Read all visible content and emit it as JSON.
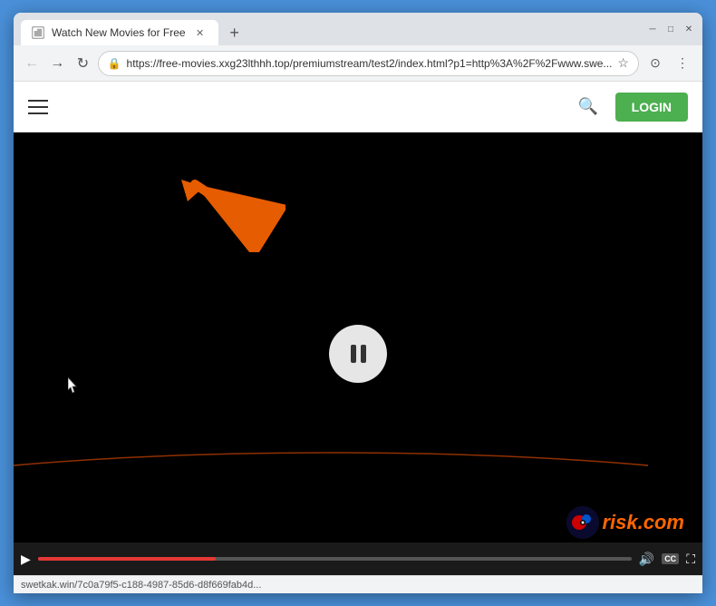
{
  "browser": {
    "tab": {
      "title": "Watch New Movies for Free",
      "favicon_label": "page"
    },
    "new_tab_symbol": "+",
    "window_controls": {
      "minimize": "─",
      "maximize": "□",
      "close": "✕"
    },
    "nav": {
      "back_label": "←",
      "forward_label": "→",
      "reload_label": "↻",
      "url": "https://free-movies.xxg23lthhh.top/premiumstream/test2/index.html?p1=http%3A%2F%2Fwww.swe...",
      "bookmark_symbol": "☆"
    },
    "nav_extra": {
      "profile": "⊙",
      "menu": "⋮"
    },
    "status_bar": {
      "text": "swetkak.win/7c0a79f5-c188-4987-85d6-d8f669fab4d..."
    }
  },
  "site": {
    "hamburger_label": "menu",
    "search_label": "search",
    "login_label": "LOGIN"
  },
  "video": {
    "pause_label": "pause",
    "arc_color": "#cc4400",
    "watermark_text": "risk.com"
  },
  "arrow": {
    "color": "#e65c00",
    "label": "annotation arrow pointing to address bar"
  },
  "controls": {
    "play_symbol": "▶",
    "volume_symbol": "🔊",
    "cc_label": "CC",
    "fullscreen_symbol": "⛶"
  }
}
